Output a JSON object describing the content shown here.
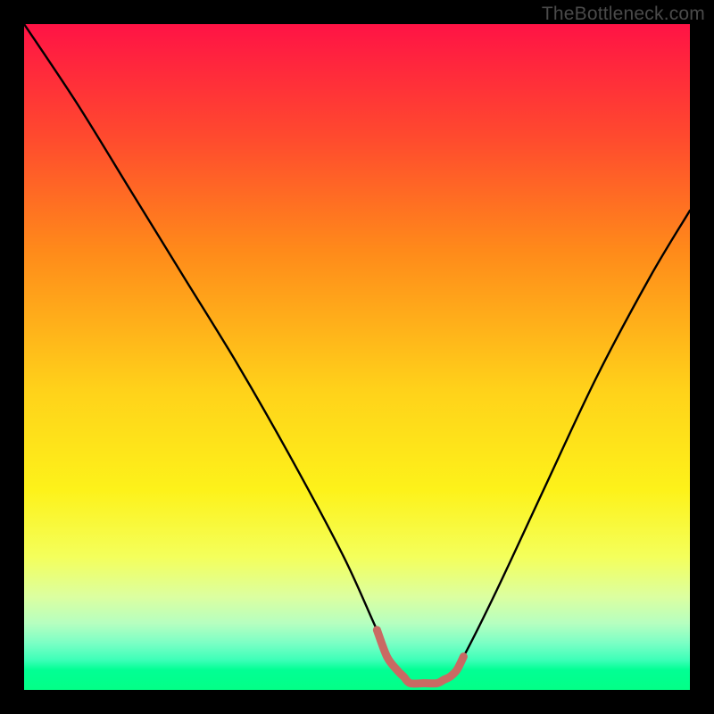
{
  "watermark": "TheBottleneck.com",
  "chart_data": {
    "type": "line",
    "title": "",
    "xlabel": "",
    "ylabel": "",
    "xlim": [
      0,
      100
    ],
    "ylim": [
      0,
      100
    ],
    "series": [
      {
        "name": "bottleneck-curve",
        "color": "#000000",
        "x": [
          0,
          8,
          16,
          24,
          32,
          40,
          48,
          53,
          56,
          58,
          62,
          64,
          66,
          71,
          78,
          86,
          94,
          100
        ],
        "values": [
          100,
          88,
          75,
          62,
          49,
          35,
          20,
          9,
          3,
          1,
          1,
          2,
          5,
          15,
          30,
          47,
          62,
          72
        ]
      },
      {
        "name": "trough-highlight",
        "color": "#c96a63",
        "x": [
          53,
          54.5,
          56,
          57,
          58,
          60,
          62,
          63,
          64,
          65,
          66
        ],
        "values": [
          9,
          5,
          3,
          2,
          1,
          1,
          1,
          1.5,
          2,
          3,
          5
        ]
      }
    ],
    "background": {
      "type": "vertical-gradient",
      "stops": [
        {
          "pos": 0,
          "color": "#ff1345"
        },
        {
          "pos": 17,
          "color": "#ff4a2e"
        },
        {
          "pos": 34,
          "color": "#ff8a1a"
        },
        {
          "pos": 55,
          "color": "#ffd21a"
        },
        {
          "pos": 70,
          "color": "#fdf21a"
        },
        {
          "pos": 80,
          "color": "#f4ff5b"
        },
        {
          "pos": 86,
          "color": "#dcffa0"
        },
        {
          "pos": 90,
          "color": "#b6ffc0"
        },
        {
          "pos": 93,
          "color": "#7affc5"
        },
        {
          "pos": 95.5,
          "color": "#3dffb8"
        },
        {
          "pos": 97,
          "color": "#02ff94"
        },
        {
          "pos": 100,
          "color": "#03ff87"
        }
      ]
    }
  }
}
